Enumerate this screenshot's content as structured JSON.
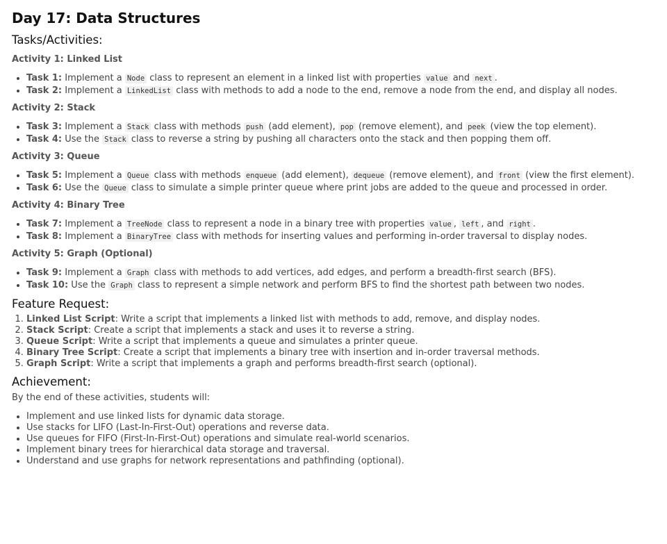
{
  "title": "Day 17: Data Structures",
  "tasks_heading": "Tasks/Activities:",
  "activities": [
    {
      "title": "Activity 1: Linked List",
      "tasks": [
        {
          "label": "Task 1:",
          "parts": [
            {
              "t": " Implement a "
            },
            {
              "c": "Node"
            },
            {
              "t": " class to represent an element in a linked list with properties "
            },
            {
              "c": "value"
            },
            {
              "t": " and "
            },
            {
              "c": "next"
            },
            {
              "t": "."
            }
          ]
        },
        {
          "label": "Task 2:",
          "parts": [
            {
              "t": " Implement a "
            },
            {
              "c": "LinkedList"
            },
            {
              "t": " class with methods to add a node to the end, remove a node from the end, and display all nodes."
            }
          ]
        }
      ]
    },
    {
      "title": "Activity 2: Stack",
      "tasks": [
        {
          "label": "Task 3:",
          "parts": [
            {
              "t": " Implement a "
            },
            {
              "c": "Stack"
            },
            {
              "t": " class with methods "
            },
            {
              "c": "push"
            },
            {
              "t": " (add element), "
            },
            {
              "c": "pop"
            },
            {
              "t": " (remove element), and "
            },
            {
              "c": "peek"
            },
            {
              "t": " (view the top element)."
            }
          ]
        },
        {
          "label": "Task 4:",
          "parts": [
            {
              "t": " Use the "
            },
            {
              "c": "Stack"
            },
            {
              "t": " class to reverse a string by pushing all characters onto the stack and then popping them off."
            }
          ]
        }
      ]
    },
    {
      "title": "Activity 3: Queue",
      "tasks": [
        {
          "label": "Task 5:",
          "parts": [
            {
              "t": " Implement a "
            },
            {
              "c": "Queue"
            },
            {
              "t": " class with methods "
            },
            {
              "c": "enqueue"
            },
            {
              "t": " (add element), "
            },
            {
              "c": "dequeue"
            },
            {
              "t": " (remove element), and "
            },
            {
              "c": "front"
            },
            {
              "t": " (view the first element)."
            }
          ]
        },
        {
          "label": "Task 6:",
          "parts": [
            {
              "t": " Use the "
            },
            {
              "c": "Queue"
            },
            {
              "t": " class to simulate a simple printer queue where print jobs are added to the queue and processed in order."
            }
          ]
        }
      ]
    },
    {
      "title": "Activity 4: Binary Tree",
      "tasks": [
        {
          "label": "Task 7:",
          "parts": [
            {
              "t": " Implement a "
            },
            {
              "c": "TreeNode"
            },
            {
              "t": " class to represent a node in a binary tree with properties "
            },
            {
              "c": "value"
            },
            {
              "t": ", "
            },
            {
              "c": "left"
            },
            {
              "t": ", and "
            },
            {
              "c": "right"
            },
            {
              "t": "."
            }
          ]
        },
        {
          "label": "Task 8:",
          "parts": [
            {
              "t": " Implement a "
            },
            {
              "c": "BinaryTree"
            },
            {
              "t": " class with methods for inserting values and performing in-order traversal to display nodes."
            }
          ]
        }
      ]
    },
    {
      "title": "Activity 5: Graph (Optional)",
      "tasks": [
        {
          "label": "Task 9:",
          "parts": [
            {
              "t": " Implement a "
            },
            {
              "c": "Graph"
            },
            {
              "t": " class with methods to add vertices, add edges, and perform a breadth-first search (BFS)."
            }
          ]
        },
        {
          "label": "Task 10:",
          "parts": [
            {
              "t": " Use the "
            },
            {
              "c": "Graph"
            },
            {
              "t": " class to represent a simple network and perform BFS to find the shortest path between two nodes."
            }
          ]
        }
      ]
    }
  ],
  "feature_heading": "Feature Request:",
  "features": [
    {
      "label": "Linked List Script",
      "text": ": Write a script that implements a linked list with methods to add, remove, and display nodes."
    },
    {
      "label": "Stack Script",
      "text": ": Create a script that implements a stack and uses it to reverse a string."
    },
    {
      "label": "Queue Script",
      "text": ": Write a script that implements a queue and simulates a printer queue."
    },
    {
      "label": "Binary Tree Script",
      "text": ": Create a script that implements a binary tree with insertion and in-order traversal methods."
    },
    {
      "label": "Graph Script",
      "text": ": Write a script that implements a graph and performs breadth-first search (optional)."
    }
  ],
  "achievement_heading": "Achievement:",
  "achievement_intro": "By the end of these activities, students will:",
  "achievements": [
    "Implement and use linked lists for dynamic data storage.",
    "Use stacks for LIFO (Last-In-First-Out) operations and reverse data.",
    "Use queues for FIFO (First-In-First-Out) operations and simulate real-world scenarios.",
    "Implement binary trees for hierarchical data storage and traversal.",
    "Understand and use graphs for network representations and pathfinding (optional)."
  ]
}
